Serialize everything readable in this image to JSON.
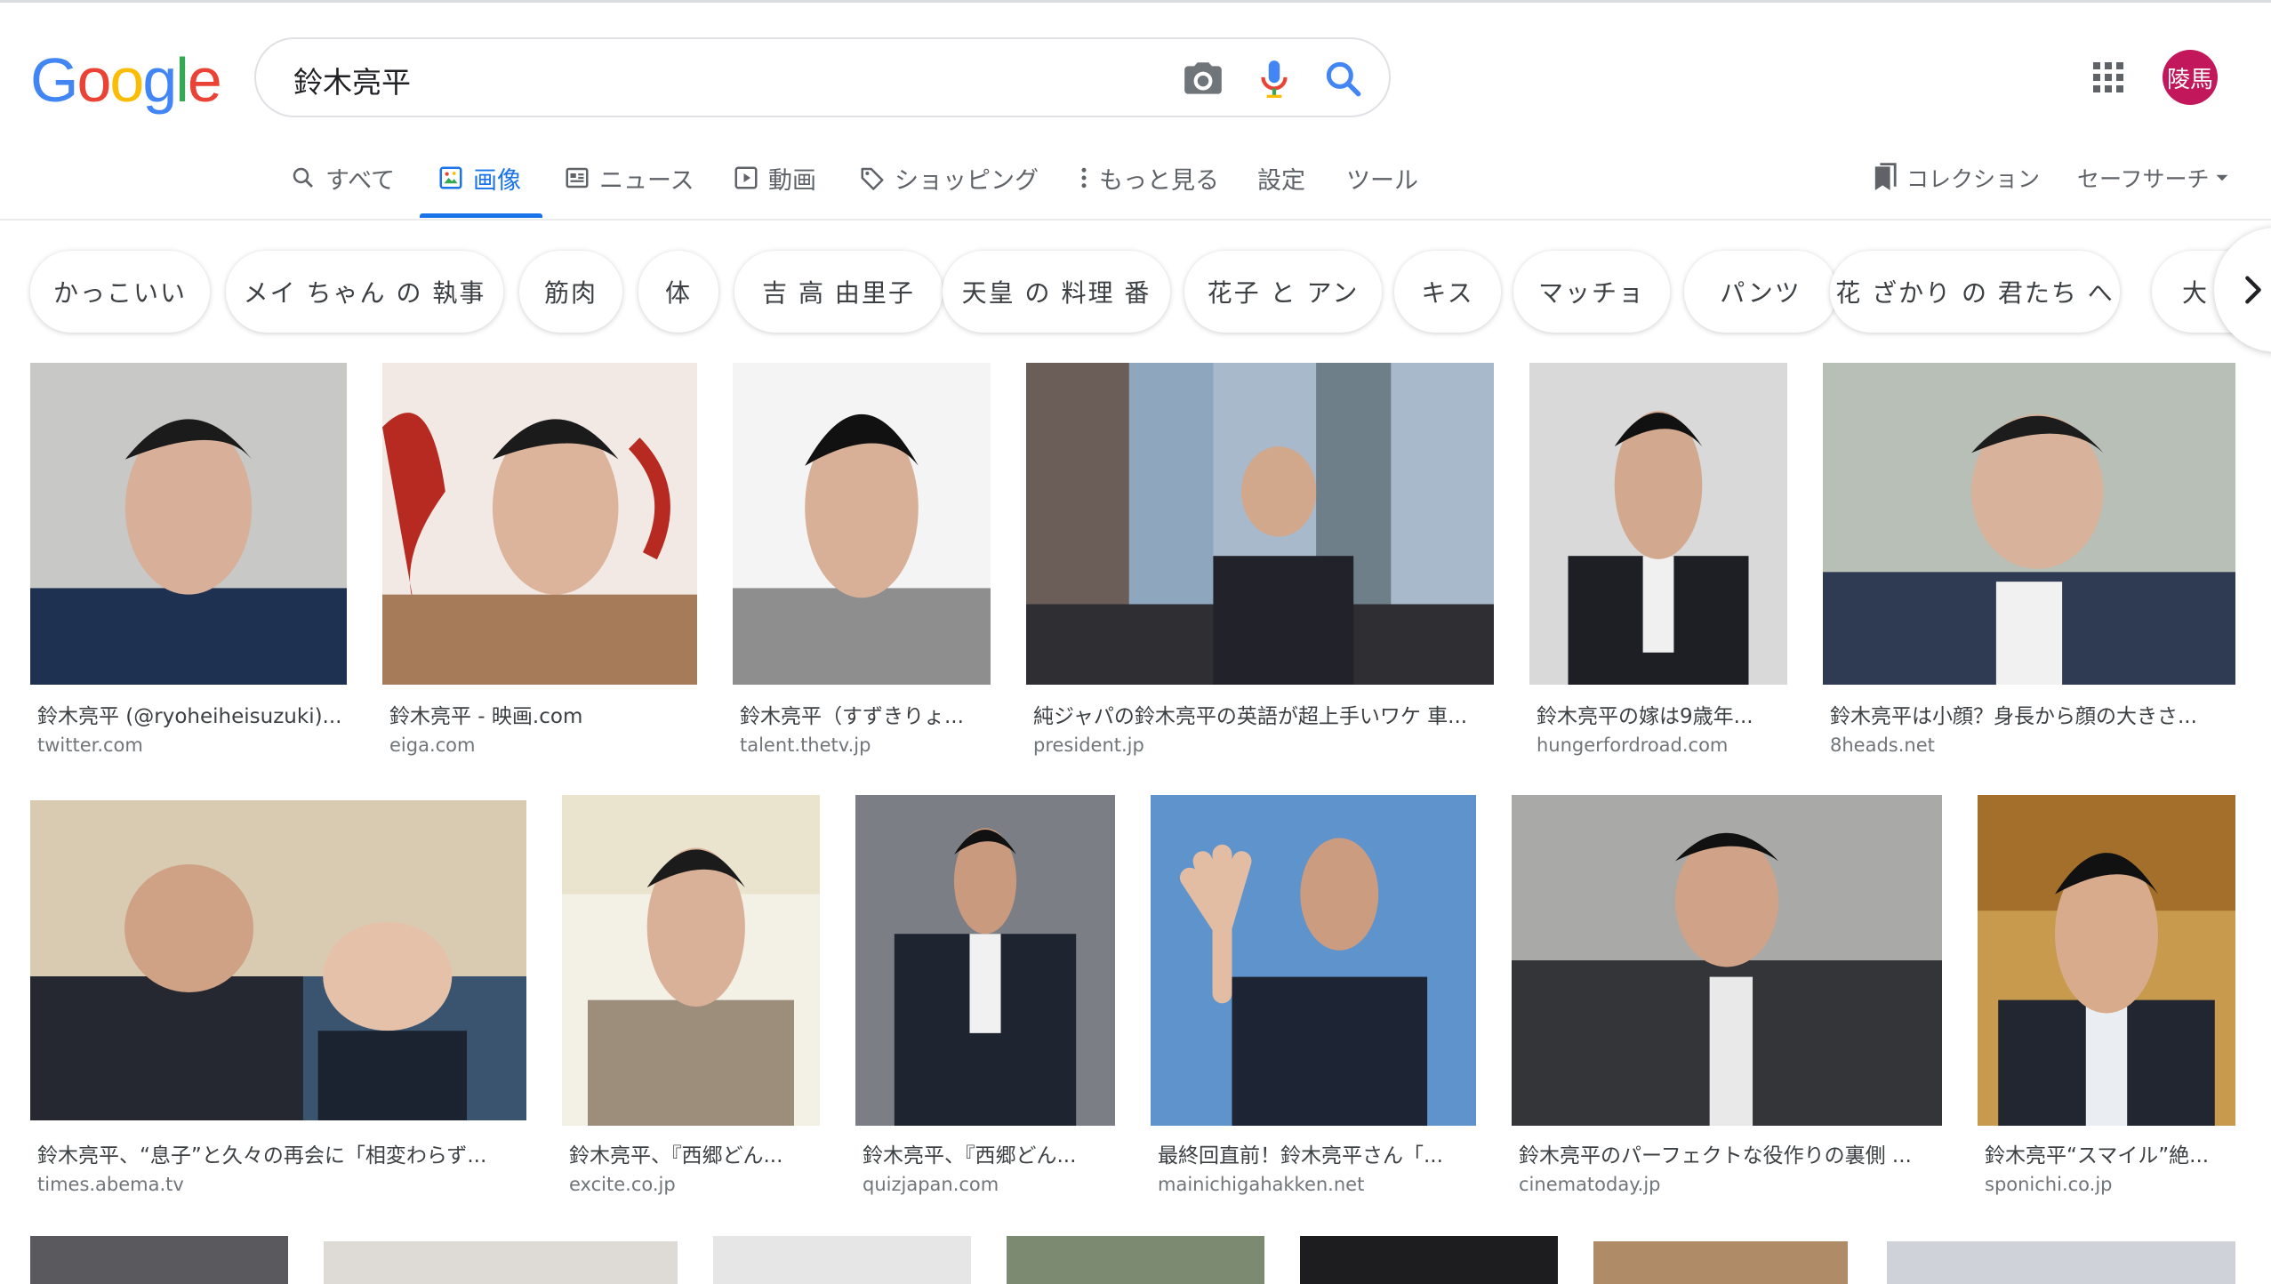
{
  "header": {
    "logo_letters": [
      {
        "char": "G",
        "color": "#4285f4"
      },
      {
        "char": "o",
        "color": "#ea4335"
      },
      {
        "char": "o",
        "color": "#fbbc05"
      },
      {
        "char": "g",
        "color": "#4285f4"
      },
      {
        "char": "l",
        "color": "#34a853"
      },
      {
        "char": "e",
        "color": "#ea4335"
      }
    ],
    "search_query": "鈴木亮平",
    "camera_icon": "camera-icon",
    "mic_icon": "mic-icon",
    "search_icon": "search-icon",
    "apps_icon": "apps-grid-icon",
    "avatar_text": "陵馬",
    "avatar_color": "#c2185b"
  },
  "tabs": [
    {
      "label": "すべて",
      "icon": "search-icon"
    },
    {
      "label": "画像",
      "icon": "image-icon",
      "active": true
    },
    {
      "label": "ニュース",
      "icon": "news-icon"
    },
    {
      "label": "動画",
      "icon": "video-icon"
    },
    {
      "label": "ショッピング",
      "icon": "tag-icon"
    },
    {
      "label": "もっと見る",
      "icon": "more-vert-icon"
    },
    {
      "label": "設定"
    },
    {
      "label": "ツール"
    }
  ],
  "right_tabs": {
    "collections_label": "コレクション",
    "safesearch_label": "セーフサーチ"
  },
  "chips": [
    "かっこいい",
    "メイ ちゃん の 執事",
    "筋肉",
    "体",
    "吉 高 由里子",
    "天皇 の 料理 番",
    "花子 と アン",
    "キス",
    "マッチョ",
    "パンツ",
    "花 ざかり の 君たち へ",
    "大"
  ],
  "results_row1": [
    {
      "title": "鈴木亮平 (@ryoheiheisuzuki)...",
      "source": "twitter.com"
    },
    {
      "title": "鈴木亮平 - 映画.com",
      "source": "eiga.com"
    },
    {
      "title": "鈴木亮平（すずきりょ...",
      "source": "talent.thetv.jp"
    },
    {
      "title": "純ジャパの鈴木亮平の英語が超上手いワケ 車...",
      "source": "president.jp"
    },
    {
      "title": "鈴木亮平の嫁は9歳年...",
      "source": "hungerfordroad.com"
    },
    {
      "title": "鈴木亮平は小顔？身長から顔の大きさ...",
      "source": "8heads.net"
    }
  ],
  "results_row2": [
    {
      "title": "鈴木亮平、“息子”と久々の再会に「相変わらず...",
      "source": "times.abema.tv"
    },
    {
      "title": "鈴木亮平、『西郷どん...",
      "source": "excite.co.jp"
    },
    {
      "title": "鈴木亮平、『西郷どん...",
      "source": "quizjapan.com"
    },
    {
      "title": "最終回直前！鈴木亮平さん「...",
      "source": "mainichigahakken.net"
    },
    {
      "title": "鈴木亮平のパーフェクトな役作りの裏側 ...",
      "source": "cinematoday.jp"
    },
    {
      "title": "鈴木亮平“スマイル”絶...",
      "source": "sponichi.co.jp"
    }
  ],
  "colors": {
    "accent": "#1a73e8",
    "tab_text": "#5f6368",
    "source_text": "#70757a"
  }
}
